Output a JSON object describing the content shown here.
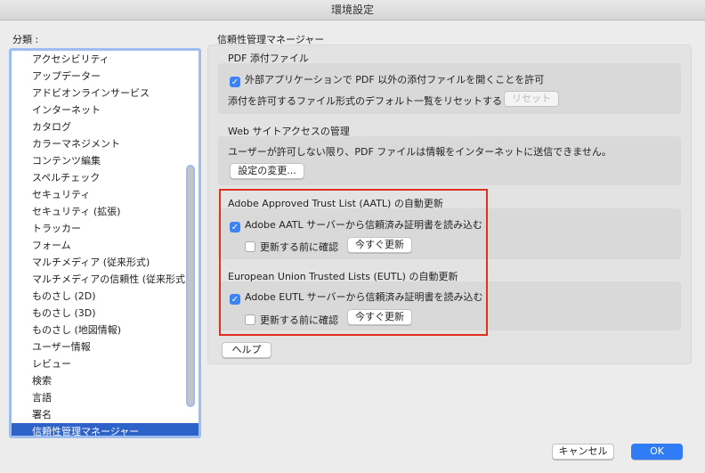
{
  "window": {
    "title": "環境設定"
  },
  "sidebar": {
    "label": "分類 :",
    "items": [
      "アクセシビリティ",
      "アップデーター",
      "アドビオンラインサービス",
      "インターネット",
      "カタログ",
      "カラーマネジメント",
      "コンテンツ編集",
      "スペルチェック",
      "セキュリティ",
      "セキュリティ (拡張)",
      "トラッカー",
      "フォーム",
      "マルチメディア (従来形式)",
      "マルチメディアの信頼性 (従来形式)",
      "ものさし (2D)",
      "ものさし (3D)",
      "ものさし (地図情報)",
      "ユーザー情報",
      "レビュー",
      "検索",
      "言語",
      "署名",
      "信頼性管理マネージャー"
    ],
    "selected": "信頼性管理マネージャー"
  },
  "panel": {
    "title": "信頼性管理マネージャー",
    "pdf_attach": {
      "title": "PDF 添付ファイル",
      "checkbox": "外部アプリケーションで PDF 以外の添付ファイルを開くことを許可",
      "checked": true,
      "reset_text": "添付を許可するファイル形式のデフォルト一覧をリセットする :",
      "reset_button": "リセット"
    },
    "web": {
      "title": "Web サイトアクセスの管理",
      "text": "ユーザーが許可しない限り、PDF ファイルは情報をインターネットに送信できません。",
      "button": "設定の変更..."
    },
    "aatl": {
      "title": "Adobe Approved Trust List (AATL) の自動更新",
      "checkbox": "Adobe AATL サーバーから信頼済み証明書を読み込む",
      "checked": true,
      "confirm": "更新する前に確認",
      "confirm_checked": false,
      "button": "今すぐ更新"
    },
    "eutl": {
      "title": "European Union Trusted Lists (EUTL) の自動更新",
      "checkbox": "Adobe EUTL サーバーから信頼済み証明書を読み込む",
      "checked": true,
      "confirm": "更新する前に確認",
      "confirm_checked": false,
      "button": "今すぐ更新"
    },
    "help": "ヘルプ"
  },
  "footer": {
    "cancel": "キャンセル",
    "ok": "OK"
  },
  "colors": {
    "accent": "#2f7cf6",
    "selection": "#2d62c8",
    "highlight": "#e0301e"
  }
}
